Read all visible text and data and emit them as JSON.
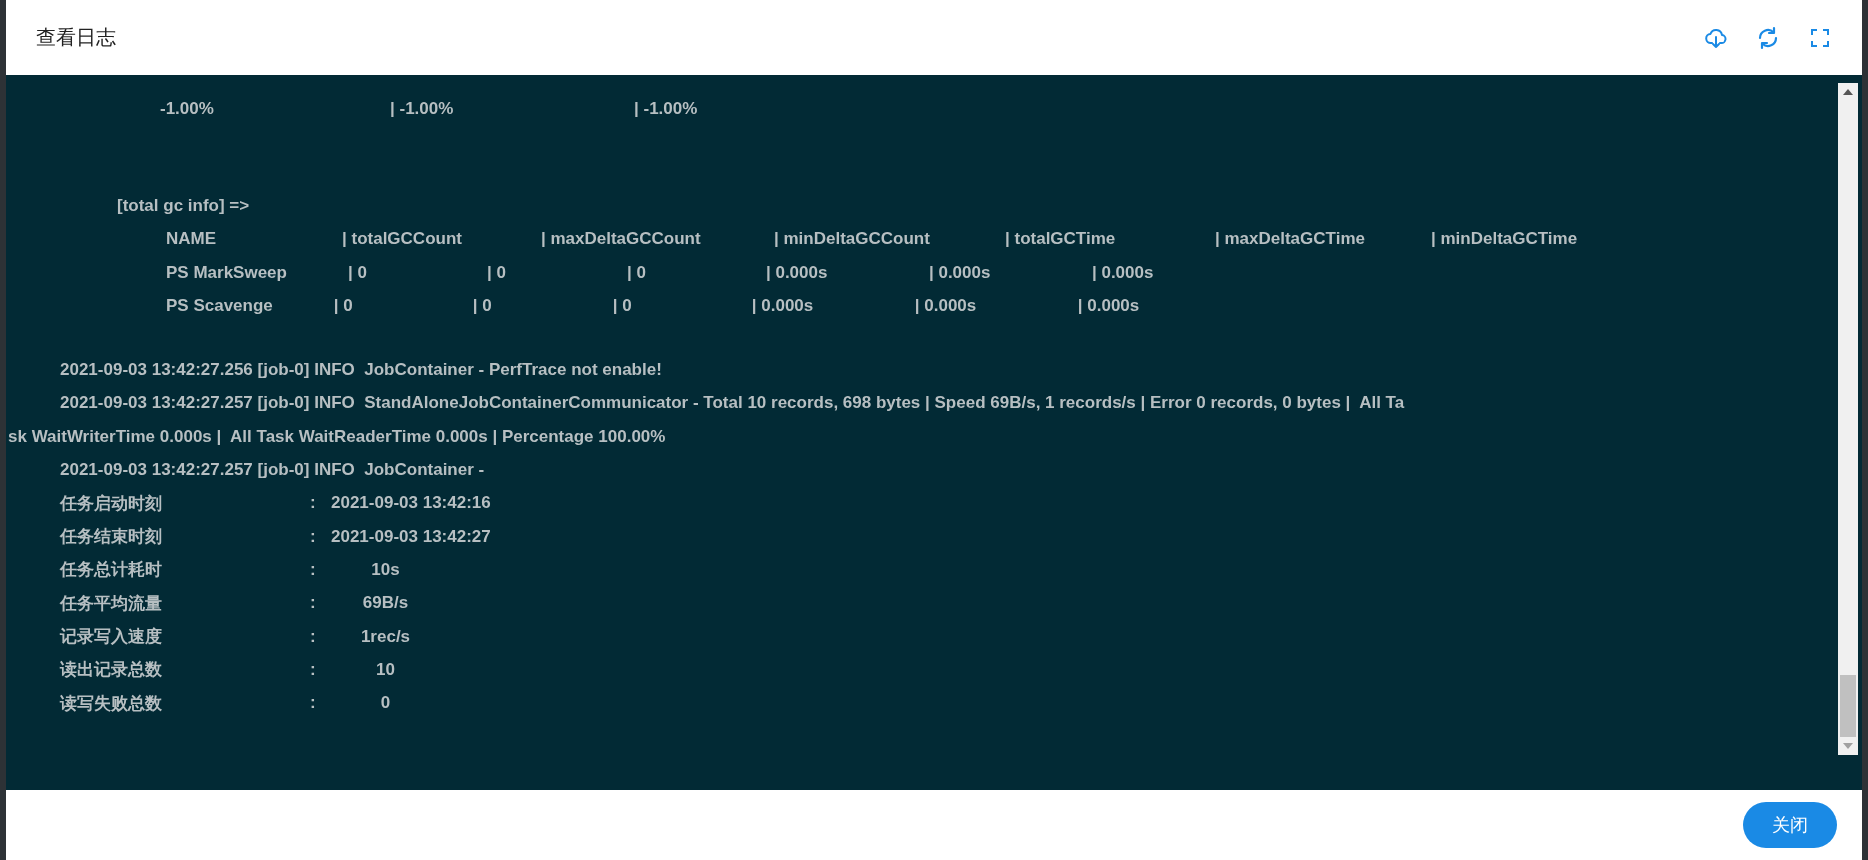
{
  "dialog": {
    "title": "查看日志",
    "toolbar": [
      {
        "kind": "download"
      },
      {
        "kind": "refresh"
      },
      {
        "kind": "fullscreen"
      }
    ],
    "log_blocks": [
      {
        "kind": "percent",
        "lines": [
          {
            "kind": "percent-row",
            "cells": [
              "-1.00%",
              "| -1.00%",
              "| -1.00%"
            ]
          }
        ]
      },
      {
        "kind": "gc-info",
        "lines": [
          {
            "kind": "heading",
            "cells": [
              "[total gc info] =>"
            ]
          },
          {
            "kind": "gc-header",
            "cells": [
              "NAME",
              "| totalGCCount",
              "| maxDeltaGCCount",
              "| minDeltaGCCount",
              "| totalGCTime",
              "| maxDeltaGCTime",
              "| minDeltaGCTime"
            ]
          },
          {
            "kind": "gc-row",
            "cells": [
              "PS MarkSweep",
              "| 0",
              "| 0",
              "| 0",
              "| 0.000s",
              "| 0.000s",
              "| 0.000s"
            ]
          },
          {
            "kind": "gc-row",
            "cells": [
              "PS Scavenge",
              "| 0",
              "| 0",
              "| 0",
              "| 0.000s",
              "| 0.000s",
              "| 0.000s"
            ]
          }
        ]
      },
      {
        "kind": "job-log",
        "lines": [
          {
            "kind": "log",
            "cells": [
              "2021-09-03 13:42:27.256 [job-0] INFO  JobContainer - PerfTrace not enable!"
            ]
          },
          {
            "kind": "log",
            "cells": [
              "2021-09-03 13:42:27.257 [job-0] INFO  StandAloneJobContainerCommunicator - Total 10 records, 698 bytes | Speed 69B/s, 1 records/s | Error 0 records, 0 bytes |  All Ta"
            ]
          },
          {
            "kind": "continuation",
            "cells": [
              "sk WaitWriterTime 0.000s |  All Task WaitReaderTime 0.000s | Percentage 100.00%"
            ]
          },
          {
            "kind": "log",
            "cells": [
              "2021-09-03 13:42:27.257 [job-0] INFO  JobContainer -"
            ]
          },
          {
            "kind": "summary-time",
            "cells": [
              "任务启动时刻",
              ":",
              "2021-09-03 13:42:16"
            ]
          },
          {
            "kind": "summary-time",
            "cells": [
              "任务结束时刻",
              ":",
              "2021-09-03 13:42:27"
            ]
          },
          {
            "kind": "summary-stat",
            "cells": [
              "任务总计耗时",
              ":",
              "10s"
            ]
          },
          {
            "kind": "summary-stat",
            "cells": [
              "任务平均流量",
              ":",
              "69B/s"
            ]
          },
          {
            "kind": "summary-stat",
            "cells": [
              "记录写入速度",
              ":",
              "1rec/s"
            ]
          },
          {
            "kind": "summary-stat",
            "cells": [
              "读出记录总数",
              ":",
              "10"
            ]
          },
          {
            "kind": "summary-stat",
            "cells": [
              "读写失败总数",
              ":",
              "0"
            ]
          }
        ]
      }
    ],
    "close_button": "关闭"
  }
}
